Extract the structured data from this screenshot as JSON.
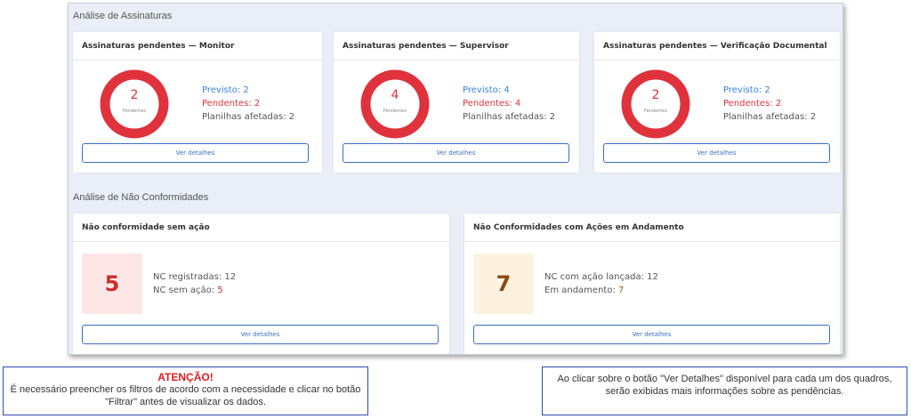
{
  "signatures": {
    "section_title": "Análise de Assinaturas",
    "cards": [
      {
        "title": "Assinaturas pendentes — Monitor",
        "count": "2",
        "count_label": "Pendentes",
        "previsto": "Previsto: 2",
        "pendentes": "Pendentes: 2",
        "planilhas": "Planilhas afetadas: 2",
        "button": "Ver detalhes"
      },
      {
        "title": "Assinaturas pendentes — Supervisor",
        "count": "4",
        "count_label": "Pendentes",
        "previsto": "Previsto: 4",
        "pendentes": "Pendentes: 4",
        "planilhas": "Planilhas afetadas: 2",
        "button": "Ver detalhes"
      },
      {
        "title": "Assinaturas pendentes — Verificação Documental",
        "count": "2",
        "count_label": "Pendentes",
        "previsto": "Previsto: 2",
        "pendentes": "Pendentes: 2",
        "planilhas": "Planilhas afetadas: 2",
        "button": "Ver detalhes"
      }
    ]
  },
  "nonconformities": {
    "section_title": "Análise de Não Conformidades",
    "cards": [
      {
        "title": "Não conformidade sem ação",
        "value": "5",
        "line1": "NC registradas: 12",
        "line2_label": "NC sem ação: ",
        "line2_value": "5",
        "button": "Ver detalhes"
      },
      {
        "title": "Não Conformidades com Ações em Andamento",
        "value": "7",
        "line1": "NC com ação lançada: 12",
        "line2_label": "Em andamento: ",
        "line2_value": "7",
        "button": "Ver detalhes"
      }
    ]
  },
  "notes": {
    "left_title": "ATENÇÃO!",
    "left_text": "É necessário preencher os filtros de acordo com a necessidade e clicar no botão \"Filtrar\" antes de visualizar os dados.",
    "right_text": "Ao clicar sobre o botão \"Ver Detalhes\" disponível para cada um dos quadros, serão exibidas mais informações sobre as pendências."
  },
  "colors": {
    "donut": "#e0323c",
    "blue": "#3b84e0",
    "button": "#3b6fc4"
  }
}
